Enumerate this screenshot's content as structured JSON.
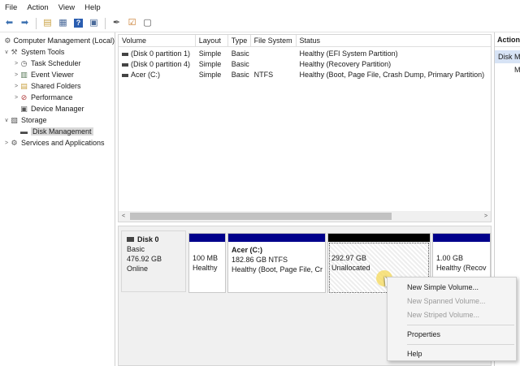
{
  "menu": [
    "File",
    "Action",
    "View",
    "Help"
  ],
  "toolbar": [
    {
      "icon": "back-arrow-icon",
      "glyph": "⬅"
    },
    {
      "icon": "forward-arrow-icon",
      "glyph": "➡"
    },
    {
      "icon": "folder-up-icon",
      "glyph": "▤"
    },
    {
      "icon": "console-tree-icon",
      "glyph": "▦"
    },
    {
      "icon": "help-icon",
      "glyph": "?"
    },
    {
      "icon": "properties-icon",
      "glyph": "▣"
    },
    {
      "icon": "key-icon",
      "glyph": "✒"
    },
    {
      "icon": "checklist-icon",
      "glyph": "☑"
    },
    {
      "icon": "window-icon",
      "glyph": "▢"
    }
  ],
  "tree": [
    {
      "label": "Computer Management (Local)",
      "icon": "computer-management-icon",
      "glyph": "⚙",
      "level": 0,
      "expander": ""
    },
    {
      "label": "System Tools",
      "icon": "system-tools-icon",
      "glyph": "⚒",
      "level": 1,
      "expander": "∨"
    },
    {
      "label": "Task Scheduler",
      "icon": "task-scheduler-icon",
      "glyph": "◷",
      "level": 2,
      "expander": ">"
    },
    {
      "label": "Event Viewer",
      "icon": "event-viewer-icon",
      "glyph": "▥",
      "level": 2,
      "expander": ">"
    },
    {
      "label": "Shared Folders",
      "icon": "shared-folders-icon",
      "glyph": "▤",
      "level": 2,
      "expander": ">"
    },
    {
      "label": "Performance",
      "icon": "performance-icon",
      "glyph": "⊘",
      "level": 2,
      "expander": ">"
    },
    {
      "label": "Device Manager",
      "icon": "device-manager-icon",
      "glyph": "▣",
      "level": 2,
      "expander": ""
    },
    {
      "label": "Storage",
      "icon": "storage-icon",
      "glyph": "▧",
      "level": 1,
      "expander": "∨"
    },
    {
      "label": "Disk Management",
      "icon": "disk-management-icon",
      "glyph": "▬",
      "level": 2,
      "expander": "",
      "selected": true
    },
    {
      "label": "Services and Applications",
      "icon": "services-icon",
      "glyph": "⚙",
      "level": 1,
      "expander": ">"
    }
  ],
  "volume_list": {
    "columns": [
      "Volume",
      "Layout",
      "Type",
      "File System",
      "Status"
    ],
    "rows": [
      [
        "(Disk 0 partition 1)",
        "Simple",
        "Basic",
        "",
        "Healthy (EFI System Partition)"
      ],
      [
        "(Disk 0 partition 4)",
        "Simple",
        "Basic",
        "",
        "Healthy (Recovery Partition)"
      ],
      [
        "Acer (C:)",
        "Simple",
        "Basic",
        "NTFS",
        "Healthy (Boot, Page File, Crash Dump, Primary Partition)"
      ]
    ],
    "scroll_left": "<",
    "scroll_right": ">"
  },
  "disk": {
    "name": "Disk 0",
    "type": "Basic",
    "size": "476.92 GB",
    "status": "Online",
    "partitions": [
      {
        "title": "",
        "size": "100 MB",
        "status": "Healthy",
        "band": "#00008b"
      },
      {
        "title": "Acer  (C:)",
        "size": "182.86 GB NTFS",
        "status": "Healthy (Boot, Page File, Cr",
        "band": "#00008b"
      },
      {
        "title": "",
        "size": "292.97 GB",
        "status": "Unallocated",
        "band": "#000000"
      },
      {
        "title": "",
        "size": "1.00 GB",
        "status": "Healthy (Recov",
        "band": "#00008b"
      }
    ]
  },
  "actions": {
    "header": "Action",
    "sub": "Disk M",
    "more": "M"
  },
  "context_menu": [
    {
      "label": "New Simple Volume...",
      "enabled": true
    },
    {
      "label": "New Spanned Volume...",
      "enabled": false
    },
    {
      "label": "New Striped Volume...",
      "enabled": false
    },
    {
      "label": "Properties",
      "enabled": true
    },
    {
      "label": "Help",
      "enabled": true
    }
  ],
  "colors": {
    "partition_band": "#00008b",
    "unallocated_band": "#000000",
    "selection": "#d9d9d9",
    "actions_highlight": "#d7e3f5"
  }
}
